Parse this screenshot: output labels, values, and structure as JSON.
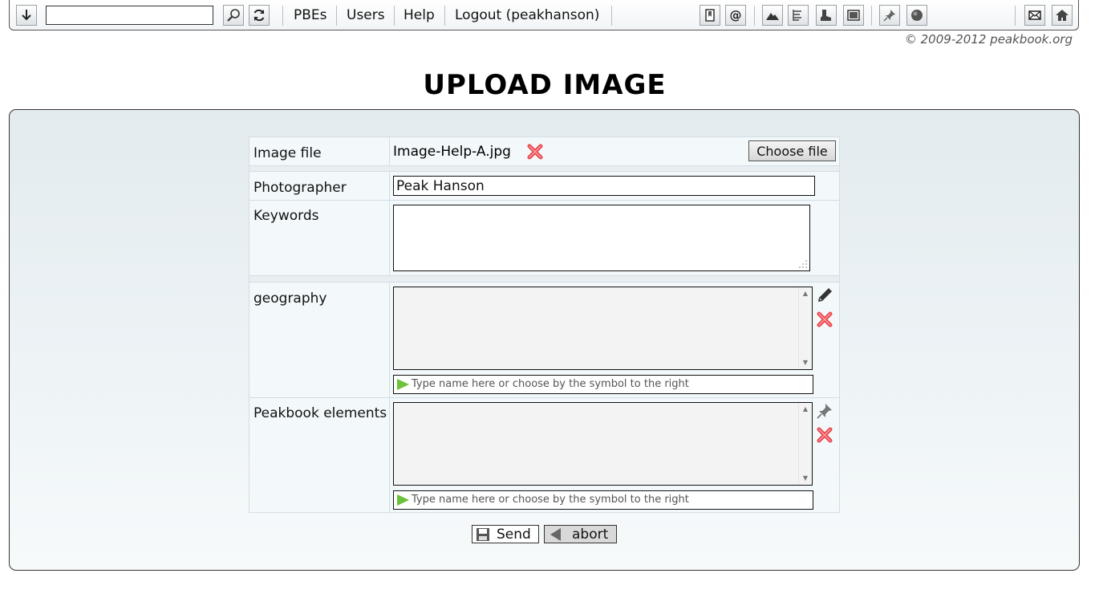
{
  "toolbar": {
    "search_value": "",
    "links": [
      "PBEs",
      "Users",
      "Help",
      "Logout (peakhanson)"
    ]
  },
  "copyright": "© 2009-2012 peakbook.org",
  "page_title": "UPLOAD IMAGE",
  "form": {
    "image_file": {
      "label": "Image file",
      "value": "Image-Help-A.jpg",
      "button": "Choose file"
    },
    "photographer": {
      "label": "Photographer",
      "value": "Peak Hanson"
    },
    "keywords": {
      "label": "Keywords",
      "value": ""
    },
    "geography": {
      "label": "geography",
      "placeholder": "Type name here or choose by the symbol to the right"
    },
    "peakbook_elements": {
      "label": "Peakbook elements",
      "placeholder": "Type name here or choose by the symbol to the right"
    }
  },
  "actions": {
    "send": "Send",
    "abort": "abort"
  },
  "colors": {
    "accent_red": "#e8454b",
    "hint_green": "#6cc23a",
    "panel_bg": "#e3ebef"
  }
}
